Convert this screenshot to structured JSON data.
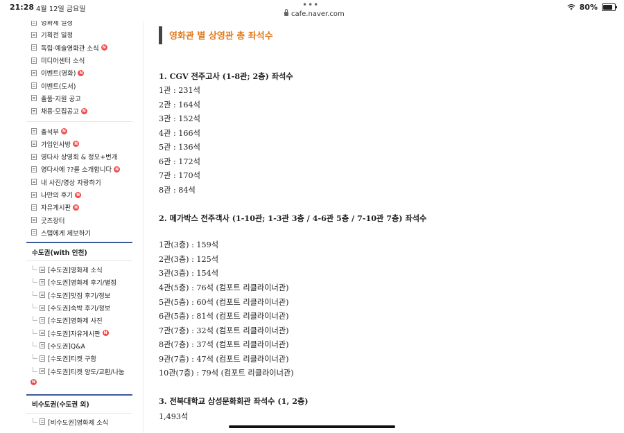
{
  "status_bar": {
    "time": "21:28",
    "date": "4월 12일 금요일",
    "dots": "•••",
    "url": "cafe.naver.com",
    "battery": "80%"
  },
  "sidebar": {
    "group1": [
      {
        "label": "영화제 일정",
        "new": false
      },
      {
        "label": "기획전 일정",
        "new": false
      },
      {
        "label": "독립·예술영화관 소식",
        "new": true
      },
      {
        "label": "미디어센터 소식",
        "new": false
      },
      {
        "label": "이벤트(영화)",
        "new": true
      },
      {
        "label": "이벤트(도서)",
        "new": false
      },
      {
        "label": "출품·지원 공고",
        "new": false
      },
      {
        "label": "채용·모집공고",
        "new": true
      }
    ],
    "group2": [
      {
        "label": "출석부",
        "new": true
      },
      {
        "label": "가입인사방",
        "new": true
      },
      {
        "label": "영다사 상영회 & 정모+번개",
        "new": false
      },
      {
        "label": "영다사에 ??를 소개합니다",
        "new": true
      },
      {
        "label": "내 사진/영상 자랑하기",
        "new": false
      },
      {
        "label": "나만의 후기",
        "new": true
      },
      {
        "label": "자유게시판",
        "new": true
      },
      {
        "label": "굿즈장터",
        "new": false
      },
      {
        "label": "스탭에게 제보하기",
        "new": false
      }
    ],
    "section1_title": "수도권(with 인천)",
    "section1_items": [
      {
        "label": "[수도권]영화제 소식",
        "new": false
      },
      {
        "label": "[수도권]영화제 후기/별점",
        "new": false
      },
      {
        "label": "[수도권]맛집 후기/정보",
        "new": false
      },
      {
        "label": "[수도권]숙박 후기/정보",
        "new": false
      },
      {
        "label": "[수도권]영화제 사진",
        "new": false
      },
      {
        "label": "[수도권]자유게시판",
        "new": true
      },
      {
        "label": "[수도권]Q&A",
        "new": false
      },
      {
        "label": "[수도권]티켓 구함",
        "new": false
      },
      {
        "label": "[수도권]티켓 양도/교환/나눔",
        "new": false
      }
    ],
    "new_badge_text": "N",
    "section2_title": "비수도권(수도권 외)",
    "section2_items": [
      {
        "label": "[비수도권]영화제 소식",
        "new": false
      }
    ]
  },
  "content": {
    "heading": "영화관 별 상영관 총 좌석수",
    "lines": [
      {
        "text": "1. CGV 전주고사 (1-8관; 2층) 좌석수",
        "bold": true
      },
      {
        "text": "1관 : 231석",
        "bold": false
      },
      {
        "text": "2관 : 164석",
        "bold": false
      },
      {
        "text": "3관 : 152석",
        "bold": false
      },
      {
        "text": "4관 : 166석",
        "bold": false
      },
      {
        "text": "5관 : 136석",
        "bold": false
      },
      {
        "text": "6관 : 172석",
        "bold": false
      },
      {
        "text": "7관 : 170석",
        "bold": false
      },
      {
        "text": "8관 : 84석",
        "bold": false
      },
      {
        "text": "2. 메가박스 전주객사 (1-10관; 1-3관 3층 / 4-6관 5층 / 7-10관 7층) 좌석수",
        "bold": true
      },
      {
        "text": "1관(3층) : 159석",
        "bold": false
      },
      {
        "text": "2관(3층) : 125석",
        "bold": false
      },
      {
        "text": "3관(3층) : 154석",
        "bold": false
      },
      {
        "text": "4관(5층) : 76석 (컴포트 리클라이너관)",
        "bold": false
      },
      {
        "text": "5관(5층) : 60석 (컴포트 리클라이너관)",
        "bold": false
      },
      {
        "text": "6관(5층) : 81석 (컴포트 리클라이너관)",
        "bold": false
      },
      {
        "text": "7관(7층) : 32석 (컴포트 리클라이너관)",
        "bold": false
      },
      {
        "text": "8관(7층) : 37석 (컴포트 리클라이너관)",
        "bold": false
      },
      {
        "text": "9관(7층) : 47석 (컴포트 리클라이너관)",
        "bold": false
      },
      {
        "text": "10관(7층) : 79석 (컴포트 리클라이너관)",
        "bold": false
      },
      {
        "text": "3. 전북대학교 삼성문화회관 좌석수 (1, 2층)",
        "bold": true
      },
      {
        "text": "1,493석",
        "bold": false
      }
    ]
  }
}
